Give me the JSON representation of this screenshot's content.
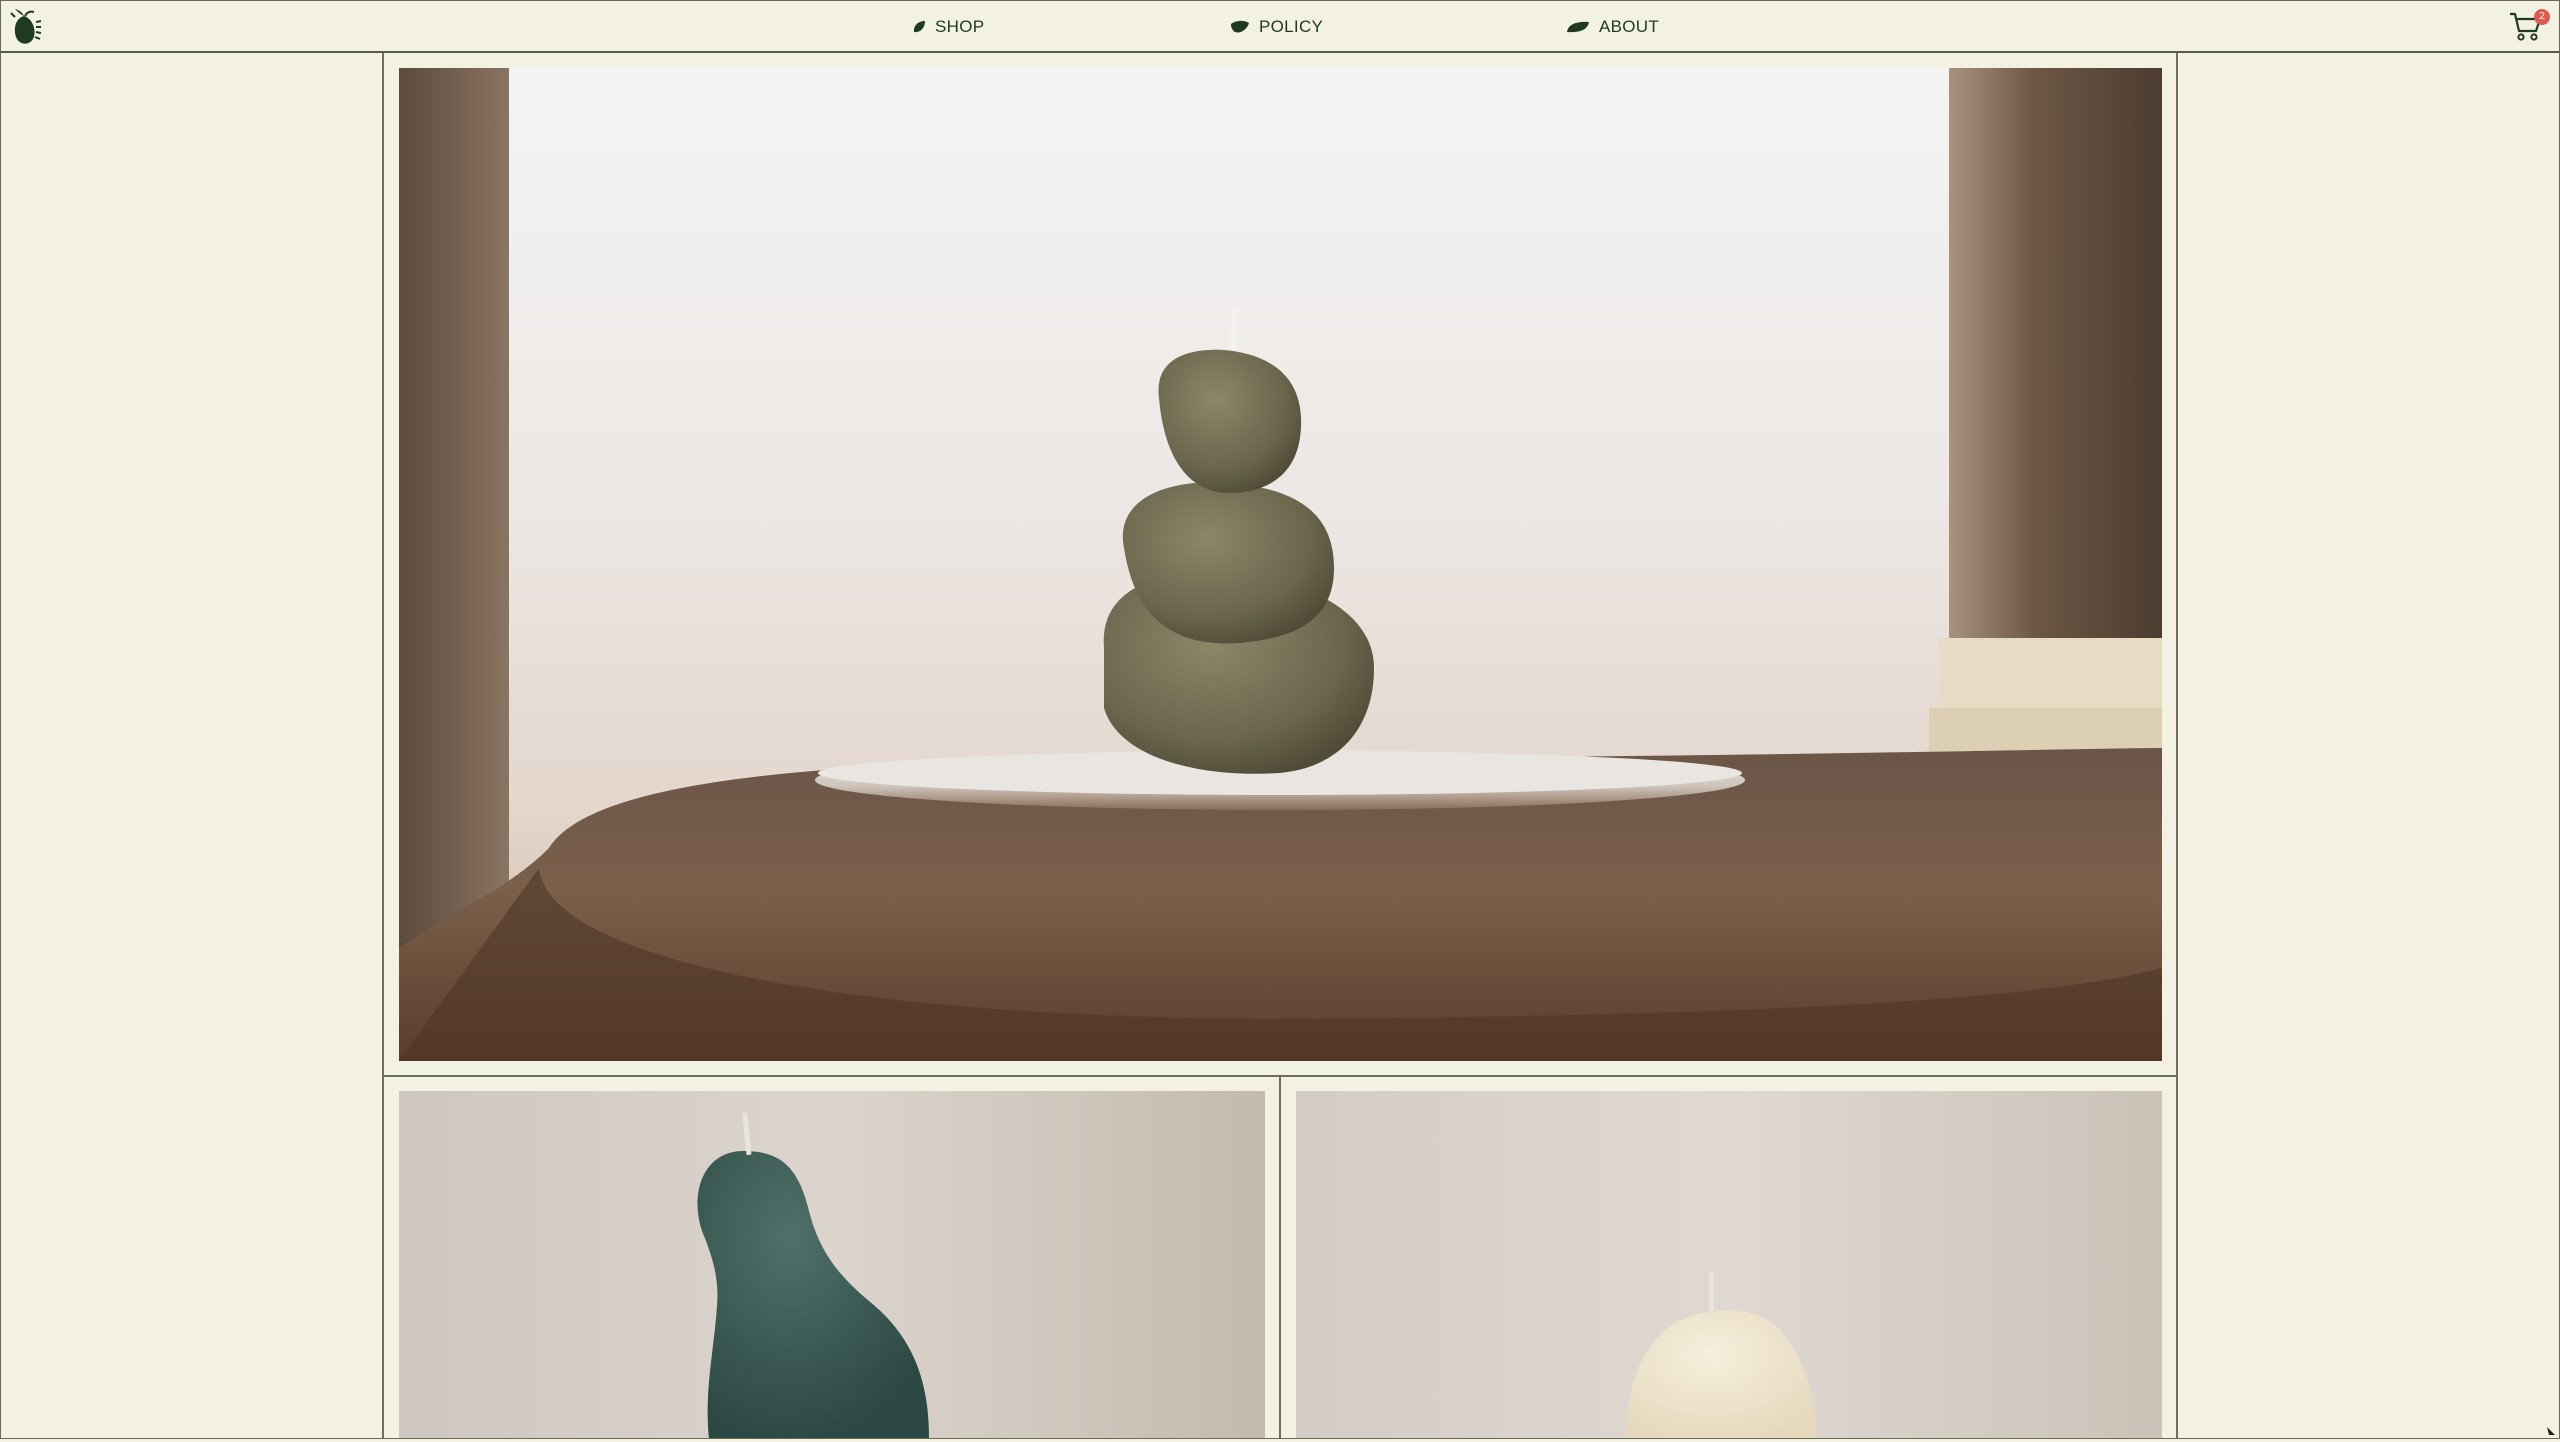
{
  "nav": {
    "shop_label": "SHOP",
    "policy_label": "POLICY",
    "about_label": "ABOUT"
  },
  "cart": {
    "count": "2"
  },
  "icons": {
    "logo": "leaf-logo-icon",
    "shop": "leaf-small-icon",
    "policy": "leaf-medium-icon",
    "about": "leaf-large-icon",
    "cart": "cart-icon"
  },
  "colors": {
    "background": "#f3f1e2",
    "brand_green": "#1f3a1e",
    "badge": "#e05a4f",
    "grid_lines": "#6d705f"
  },
  "products": [
    {
      "id": "stacked-stone-candle"
    },
    {
      "id": "green-pear-candle"
    },
    {
      "id": "cream-pear-candle"
    }
  ]
}
